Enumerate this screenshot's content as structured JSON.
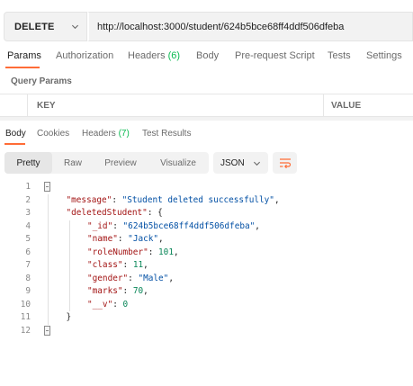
{
  "request": {
    "method": "DELETE",
    "url": "http://localhost:3000/student/624b5bce68ff4ddf506dfeba"
  },
  "request_tabs": [
    {
      "label": "Params",
      "count": ""
    },
    {
      "label": "Authorization",
      "count": ""
    },
    {
      "label": "Headers",
      "count": "(6)"
    },
    {
      "label": "Body",
      "count": ""
    },
    {
      "label": "Pre-request Script",
      "count": ""
    },
    {
      "label": "Tests",
      "count": ""
    },
    {
      "label": "Settings",
      "count": ""
    }
  ],
  "query_params": {
    "title": "Query Params",
    "key_header": "KEY",
    "value_header": "VALUE"
  },
  "response_tabs": [
    {
      "label": "Body",
      "count": ""
    },
    {
      "label": "Cookies",
      "count": ""
    },
    {
      "label": "Headers",
      "count": "(7)"
    },
    {
      "label": "Test Results",
      "count": ""
    }
  ],
  "format": {
    "views": [
      "Pretty",
      "Raw",
      "Preview",
      "Visualize"
    ],
    "active_view": "Pretty",
    "language": "JSON"
  },
  "colors": {
    "accent": "#ff6c37",
    "count": "#0cbb52",
    "json_key": "#a31515",
    "json_string": "#0451a5",
    "json_number": "#098658"
  },
  "response_body": {
    "line_numbers": [
      "1",
      "2",
      "3",
      "4",
      "5",
      "6",
      "7",
      "8",
      "9",
      "10",
      "11",
      "12"
    ],
    "lines": [
      {
        "indent": 0,
        "tokens": []
      },
      {
        "indent": 1,
        "tokens": [
          {
            "t": "key",
            "v": "\"message\""
          },
          {
            "t": "p",
            "v": ": "
          },
          {
            "t": "str",
            "v": "\"Student deleted successfully\""
          },
          {
            "t": "p",
            "v": ","
          }
        ]
      },
      {
        "indent": 1,
        "tokens": [
          {
            "t": "key",
            "v": "\"deletedStudent\""
          },
          {
            "t": "p",
            "v": ": {"
          }
        ]
      },
      {
        "indent": 2,
        "tokens": [
          {
            "t": "key",
            "v": "\"_id\""
          },
          {
            "t": "p",
            "v": ": "
          },
          {
            "t": "str",
            "v": "\"624b5bce68ff4ddf506dfeba\""
          },
          {
            "t": "p",
            "v": ","
          }
        ]
      },
      {
        "indent": 2,
        "tokens": [
          {
            "t": "key",
            "v": "\"name\""
          },
          {
            "t": "p",
            "v": ": "
          },
          {
            "t": "str",
            "v": "\"Jack\""
          },
          {
            "t": "p",
            "v": ","
          }
        ]
      },
      {
        "indent": 2,
        "tokens": [
          {
            "t": "key",
            "v": "\"roleNumber\""
          },
          {
            "t": "p",
            "v": ": "
          },
          {
            "t": "num",
            "v": "101"
          },
          {
            "t": "p",
            "v": ","
          }
        ]
      },
      {
        "indent": 2,
        "tokens": [
          {
            "t": "key",
            "v": "\"class\""
          },
          {
            "t": "p",
            "v": ": "
          },
          {
            "t": "num",
            "v": "11"
          },
          {
            "t": "p",
            "v": ","
          }
        ]
      },
      {
        "indent": 2,
        "tokens": [
          {
            "t": "key",
            "v": "\"gender\""
          },
          {
            "t": "p",
            "v": ": "
          },
          {
            "t": "str",
            "v": "\"Male\""
          },
          {
            "t": "p",
            "v": ","
          }
        ]
      },
      {
        "indent": 2,
        "tokens": [
          {
            "t": "key",
            "v": "\"marks\""
          },
          {
            "t": "p",
            "v": ": "
          },
          {
            "t": "num",
            "v": "70"
          },
          {
            "t": "p",
            "v": ","
          }
        ]
      },
      {
        "indent": 2,
        "tokens": [
          {
            "t": "key",
            "v": "\"__v\""
          },
          {
            "t": "p",
            "v": ": "
          },
          {
            "t": "num",
            "v": "0"
          }
        ]
      },
      {
        "indent": 1,
        "tokens": [
          {
            "t": "p",
            "v": "}"
          }
        ]
      },
      {
        "indent": 0,
        "tokens": []
      }
    ]
  }
}
